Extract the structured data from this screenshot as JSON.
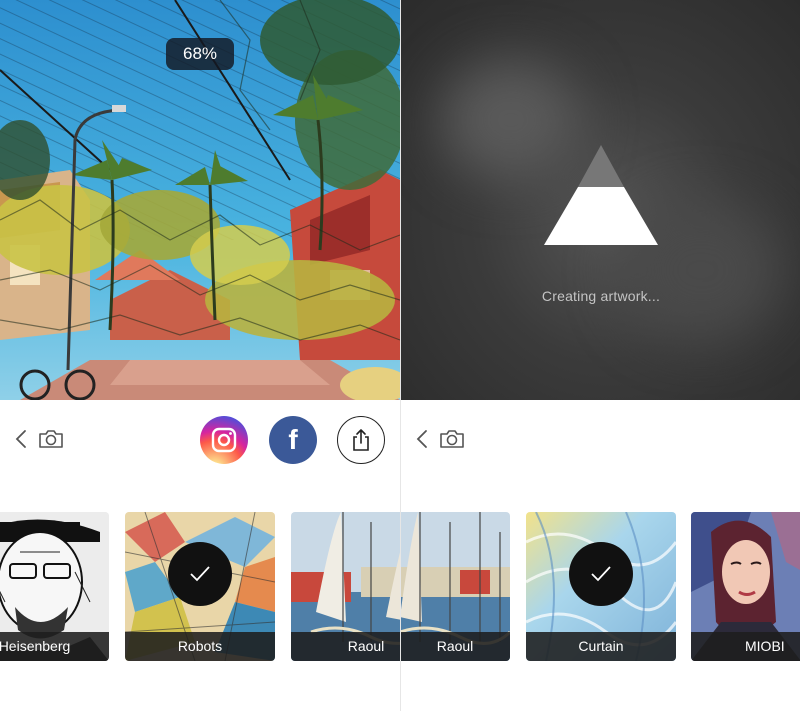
{
  "left_panel": {
    "progress_badge": "68%",
    "toolbar": {
      "back_icon": "chevron-left-icon",
      "camera_icon": "camera-icon",
      "share_buttons": [
        {
          "name": "instagram",
          "icon": "instagram-icon"
        },
        {
          "name": "facebook",
          "icon": "facebook-icon",
          "glyph": "f"
        },
        {
          "name": "share",
          "icon": "share-upload-icon"
        }
      ]
    },
    "filters": [
      {
        "label": "Heisenberg",
        "selected": false
      },
      {
        "label": "Robots",
        "selected": true
      },
      {
        "label": "Raoul",
        "selected": false
      }
    ]
  },
  "right_panel": {
    "status_text": "Creating artwork...",
    "logo_icon": "prisma-triangle-icon",
    "toolbar": {
      "back_icon": "chevron-left-icon",
      "camera_icon": "camera-icon"
    },
    "filters": [
      {
        "label": "Raoul",
        "selected": false
      },
      {
        "label": "Curtain",
        "selected": true
      },
      {
        "label": "MIOBI",
        "selected": false
      }
    ]
  },
  "colors": {
    "facebook": "#3b5998",
    "overlay": "#1e1e1e",
    "loading_bg": "#3b3b3b",
    "sky": "#3aa6d8"
  }
}
